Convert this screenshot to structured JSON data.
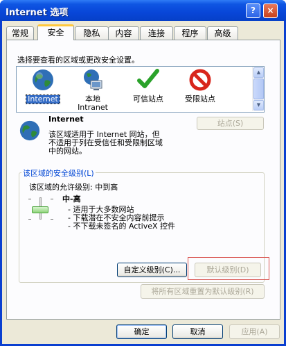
{
  "window": {
    "title": "Internet 选项",
    "help_label": "?",
    "close_label": "×"
  },
  "tabs": [
    {
      "label": "常规"
    },
    {
      "label": "安全"
    },
    {
      "label": "隐私"
    },
    {
      "label": "内容"
    },
    {
      "label": "连接"
    },
    {
      "label": "程序"
    },
    {
      "label": "高级"
    }
  ],
  "active_tab": "安全",
  "security": {
    "select_zone_prompt": "选择要查看的区域或更改安全设置。",
    "zones": [
      {
        "label": "Internet",
        "icon": "globe-icon",
        "selected": true
      },
      {
        "label": "本地\nIntranet",
        "label_line1": "本地",
        "label_line2": "Intranet",
        "icon": "intranet-icon"
      },
      {
        "label": "可信站点",
        "icon": "checkmark-icon"
      },
      {
        "label": "受限站点",
        "icon": "restricted-icon"
      }
    ],
    "zone_info_title": "Internet",
    "zone_info_line1": "该区域适用于 Internet 网站，但",
    "zone_info_line2": "不适用于列在受信任和受限制区域",
    "zone_info_line3": "中的网站。",
    "sites_button": "站点(S)",
    "level_group_title": "该区域的安全级别(L)",
    "allowed_levels": "该区域的允许级别: 中到高",
    "level_name": "中-高",
    "level_bullets": [
      "- 适用于大多数网站",
      "- 下载潜在不安全内容前提示",
      "- 不下载未签名的 ActiveX 控件"
    ],
    "custom_level_button": "自定义级别(C)...",
    "default_level_button": "默认级别(D)",
    "reset_all_button": "将所有区域重置为默认级别(R)"
  },
  "footer": {
    "ok": "确定",
    "cancel": "取消",
    "apply": "应用(A)"
  },
  "colors": {
    "title_bar": "#0846d8",
    "dialog_bg": "#ece9d8",
    "accent_tab": "#ffc83c",
    "group_title": "#0046d5",
    "highlight_box": "#d9534f"
  }
}
